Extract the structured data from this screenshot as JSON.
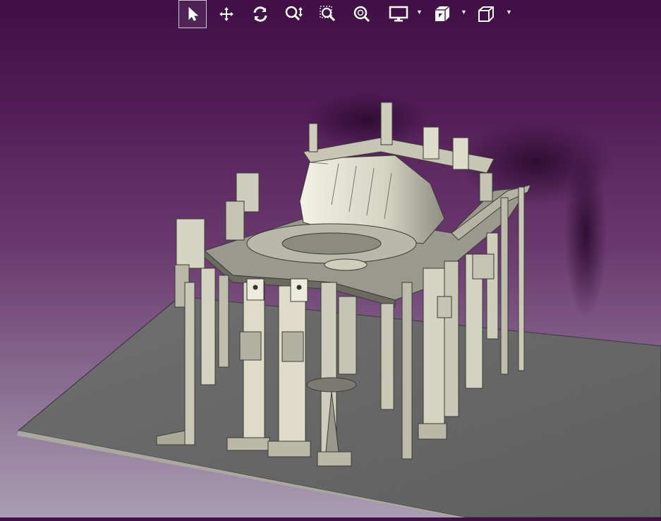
{
  "toolbar": {
    "items": [
      {
        "id": "select",
        "icon": "select-arrow-icon",
        "active": true
      },
      {
        "id": "pan",
        "icon": "pan-move-icon"
      },
      {
        "id": "rotate",
        "icon": "rotate-icon"
      },
      {
        "id": "zoom",
        "icon": "zoom-in-out-icon"
      },
      {
        "id": "zoom-window",
        "icon": "zoom-window-icon"
      },
      {
        "id": "fit-all",
        "icon": "zoom-fit-icon"
      },
      {
        "id": "display-mode",
        "icon": "monitor-icon",
        "dropdown": true
      },
      {
        "id": "section",
        "icon": "section-view-icon",
        "dropdown": true
      },
      {
        "id": "view-cube",
        "icon": "view-cube-icon",
        "dropdown": true
      }
    ]
  },
  "viewport": {
    "background_top": "#3f0f45",
    "background_bottom": "#a99db3",
    "model_plate_color": "#6d6d6d",
    "model_part_color": "#d9d6c4"
  }
}
